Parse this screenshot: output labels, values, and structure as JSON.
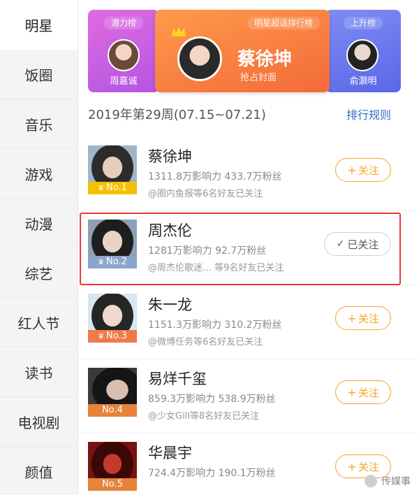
{
  "sidebar": {
    "items": [
      {
        "label": "明星",
        "active": true
      },
      {
        "label": "饭圈"
      },
      {
        "label": "音乐"
      },
      {
        "label": "游戏"
      },
      {
        "label": "动漫"
      },
      {
        "label": "综艺"
      },
      {
        "label": "红人节"
      },
      {
        "label": "读书"
      },
      {
        "label": "电视剧"
      },
      {
        "label": "颜值"
      }
    ]
  },
  "banner": {
    "left": {
      "tag": "潜力榜",
      "name": "周嘉诚"
    },
    "center": {
      "tag": "明星超话排行榜",
      "name": "蔡徐坤",
      "sub": "抢占封面"
    },
    "right": {
      "tag": "上升榜",
      "name": "俞灏明"
    }
  },
  "week": {
    "label": "2019年第29周(07.15~07.21)",
    "rules": "排行规则"
  },
  "list": [
    {
      "name": "蔡徐坤",
      "rank": "No.1",
      "stats": "1311.8万影响力 433.7万粉丝",
      "friends": "@圈内鱼报等6名好友已关注",
      "follow": "关注",
      "followed": false,
      "rank_color": "#f5c000"
    },
    {
      "name": "周杰伦",
      "rank": "No.2",
      "stats": "1281万影响力 92.7万粉丝",
      "friends": "@周杰伦歌迷… 等9名好友已关注",
      "follow": "已关注",
      "followed": true,
      "rank_color": "#8aa7c9"
    },
    {
      "name": "朱一龙",
      "rank": "No.3",
      "stats": "1151.3万影响力 310.2万粉丝",
      "friends": "@微博任务等6名好友已关注",
      "follow": "关注",
      "followed": false,
      "rank_color": "#f07a4a"
    },
    {
      "name": "易烊千玺",
      "rank": "No.4",
      "stats": "859.3万影响力 538.9万粉丝",
      "friends": "@少女Gill等8名好友已关注",
      "follow": "关注",
      "followed": false,
      "rank_color": "#e7833a"
    },
    {
      "name": "华晨宇",
      "rank": "No.5",
      "stats": "724.4万影响力 190.1万粉丝",
      "friends": "",
      "follow": "关注",
      "followed": false,
      "rank_color": "#e7833a"
    }
  ],
  "watermark": "传媒事",
  "colors": {
    "accent": "#f5a623",
    "link": "#2f6ec9",
    "highlight": "#e53935"
  }
}
